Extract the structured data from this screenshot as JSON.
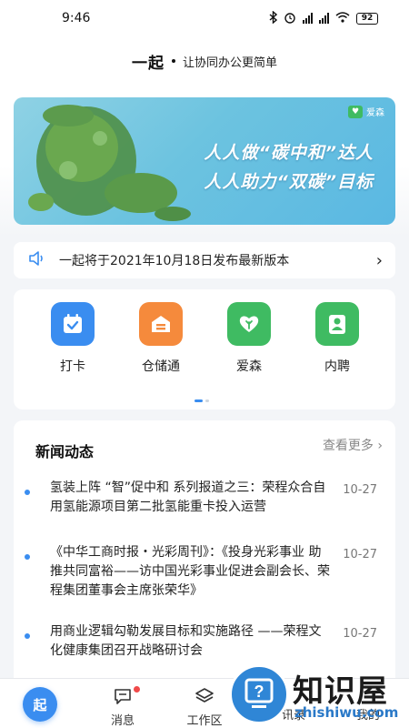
{
  "status_bar": {
    "time": "9:46",
    "battery": "92"
  },
  "header": {
    "logo": "一起",
    "slogan": "让协同办公更简单"
  },
  "banner": {
    "badge": "爱森",
    "line1": "人人做“碳中和”达人",
    "line2": "人人助力“双碳”目标"
  },
  "notice": {
    "text": "一起将于2021年10月18日发布最新版本"
  },
  "apps": [
    {
      "label": "打卡",
      "icon": "calendar-check-icon",
      "color": "#3a8df0"
    },
    {
      "label": "仓储通",
      "icon": "warehouse-icon",
      "color": "#f58a3c"
    },
    {
      "label": "爱森",
      "icon": "heart-leaf-icon",
      "color": "#3fbb62"
    },
    {
      "label": "内聘",
      "icon": "person-icon",
      "color": "#3fbb62"
    }
  ],
  "news": {
    "title": "新闻动态",
    "more": "查看更多",
    "items": [
      {
        "text": "氢装上阵 “智”促中和 系列报道之三：荣程众合自用氢能源项目第二批氢能重卡投入运营",
        "date": "10-27"
      },
      {
        "text": "《中华工商时报・光彩周刊》：《投身光彩事业 助推共同富裕——访中国光彩事业促进会副会长、荣程集团董事会主席张荣华》",
        "date": "10-27"
      },
      {
        "text": "用商业逻辑勾勒发展目标和实施路径 ——荣程文化健康集团召开战略研讨会",
        "date": "10-27"
      }
    ]
  },
  "tabbar": {
    "home": "起",
    "messages": "消息",
    "workspace": "工作区",
    "contacts": "讯录",
    "mine": "我的"
  },
  "watermark": {
    "brand": "知识屋",
    "url": "zhishiwu.com"
  }
}
